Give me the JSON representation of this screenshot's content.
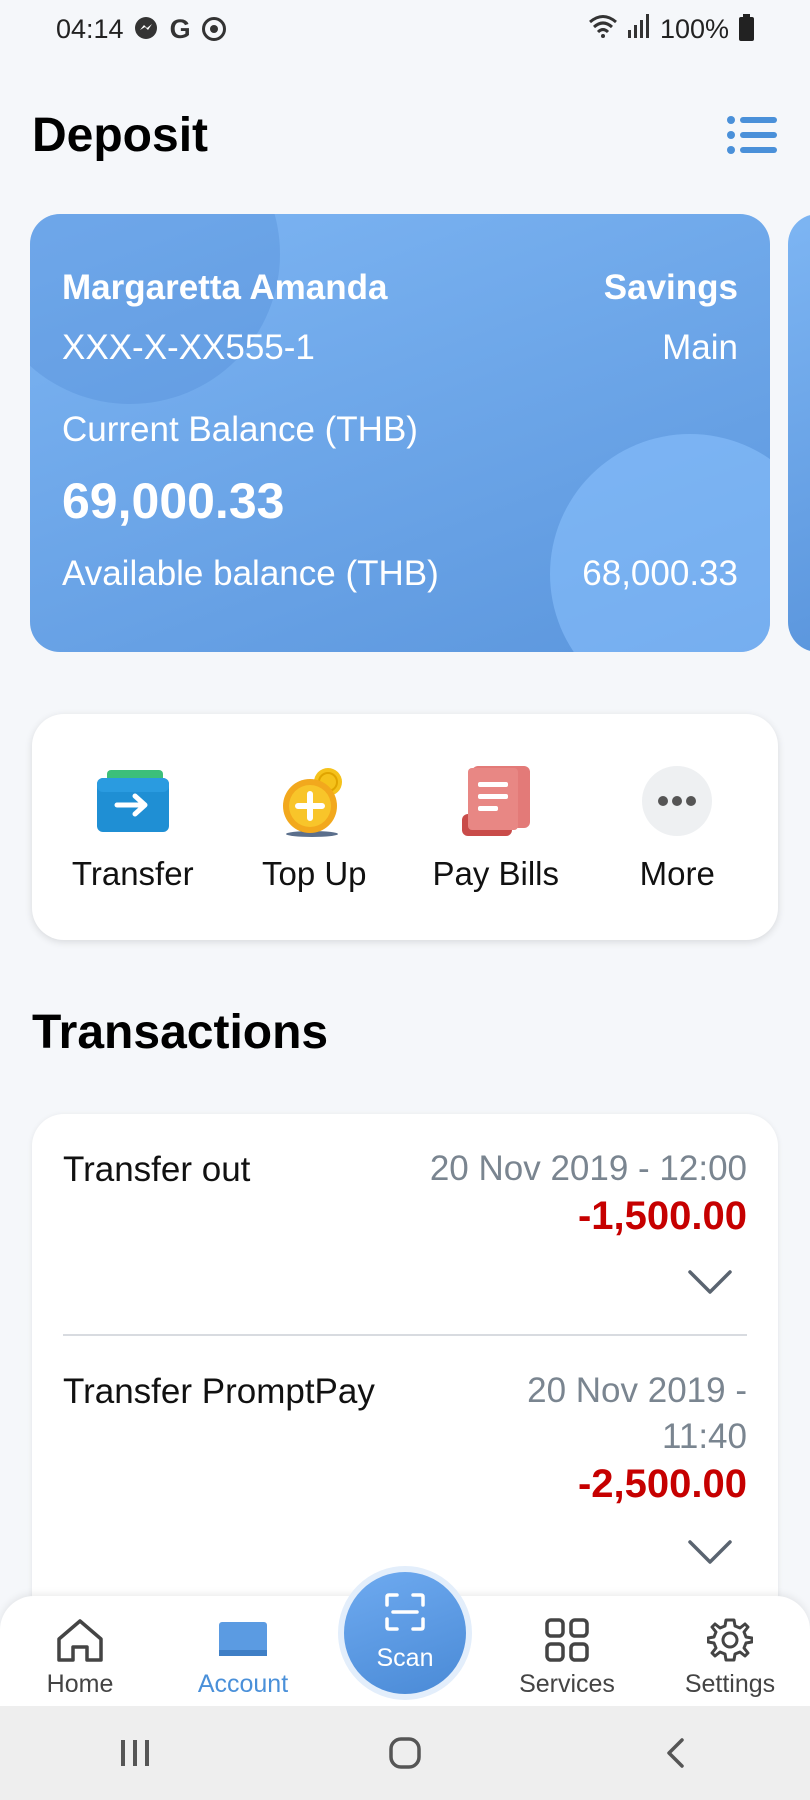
{
  "status_bar": {
    "time": "04:14",
    "battery": "100%"
  },
  "header": {
    "title": "Deposit",
    "menu_icon": "list-menu-icon"
  },
  "account_card": {
    "holder_name": "Margaretta Amanda",
    "account_type": "Savings",
    "account_number": "XXX-X-XX555-1",
    "account_label": "Main",
    "current_balance_label": "Current Balance (THB)",
    "current_balance": "69,000.33",
    "available_balance_label": "Available balance (THB)",
    "available_balance": "68,000.33",
    "colors": {
      "gradient_start": "#7db5f3",
      "gradient_end": "#5b96dd"
    }
  },
  "actions": [
    {
      "label": "Transfer",
      "icon": "wallet-transfer-icon"
    },
    {
      "label": "Top Up",
      "icon": "coin-plus-icon"
    },
    {
      "label": "Pay Bills",
      "icon": "bill-receipt-icon"
    },
    {
      "label": "More",
      "icon": "more-dots-icon"
    }
  ],
  "transactions": {
    "title": "Transactions",
    "items": [
      {
        "name": "Transfer out",
        "date_line1": "20 Nov 2019 - 12:00",
        "date_line2": "",
        "amount": "-1,500.00"
      },
      {
        "name": "Transfer PromptPay",
        "date_line1": "20 Nov 2019 -",
        "date_line2": "11:40",
        "amount": "-2,500.00"
      }
    ],
    "amount_color": "#c60000"
  },
  "bottom_nav": {
    "items": [
      {
        "label": "Home",
        "icon": "home-icon"
      },
      {
        "label": "Account",
        "icon": "account-card-icon",
        "active": true
      },
      {
        "label": "Services",
        "icon": "grid-icon"
      },
      {
        "label": "Settings",
        "icon": "gear-icon"
      }
    ],
    "scan_label": "Scan",
    "active_color": "#4a90d9"
  },
  "system_nav": {
    "buttons": [
      "recent-apps-icon",
      "home-circle-icon",
      "back-icon"
    ]
  }
}
